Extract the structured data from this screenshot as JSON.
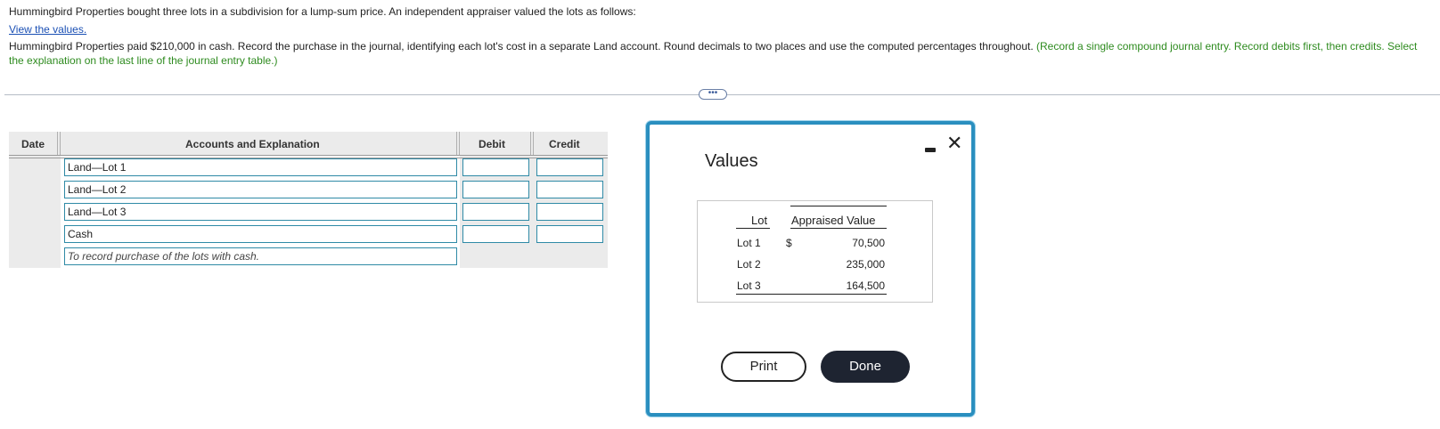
{
  "intro": {
    "line1": "Hummingbird Properties bought three lots in a subdivision for a lump-sum price. An independent appraiser valued the lots as follows:",
    "link": "View the values.",
    "line2": "Hummingbird Properties paid $210,000 in cash. Record the purchase in the journal, identifying each lot's cost in a separate Land account. Round decimals to two places and use the computed percentages throughout.",
    "instruction": "(Record a single compound journal entry. Record debits first, then credits. Select the explanation on the last line of the journal entry table.)"
  },
  "more_button": "•••",
  "journal": {
    "headers": {
      "date": "Date",
      "accounts": "Accounts and Explanation",
      "debit": "Debit",
      "credit": "Credit"
    },
    "rows": [
      {
        "account": "Land—Lot 1",
        "debit": "",
        "credit": ""
      },
      {
        "account": "Land—Lot 2",
        "debit": "",
        "credit": ""
      },
      {
        "account": "Land—Lot 3",
        "debit": "",
        "credit": ""
      },
      {
        "account": "Cash",
        "debit": "",
        "credit": ""
      }
    ],
    "explanation": "To record purchase of the lots with cash."
  },
  "modal": {
    "title": "Values",
    "table": {
      "headers": {
        "lot": "Lot",
        "value": "Appraised Value"
      },
      "currency": "$",
      "rows": [
        {
          "lot": "Lot 1",
          "value": "70,500"
        },
        {
          "lot": "Lot 2",
          "value": "235,000"
        },
        {
          "lot": "Lot 3",
          "value": "164,500"
        }
      ]
    },
    "print_label": "Print",
    "done_label": "Done",
    "close_glyph": "✕"
  },
  "colors": {
    "accent": "#2a8fbf",
    "green_text": "#2e8b1f",
    "link": "#1a4fb4",
    "done_bg": "#1e2431"
  }
}
